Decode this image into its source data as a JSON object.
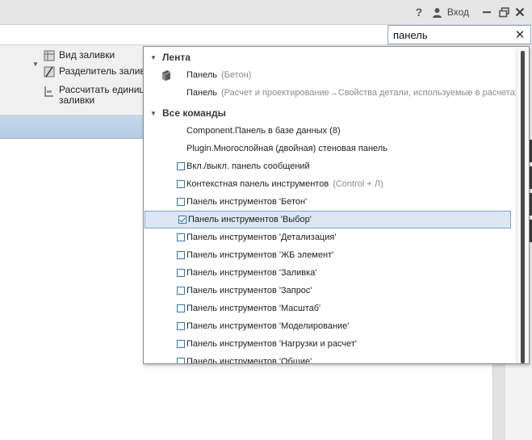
{
  "window": {
    "help_label": "?",
    "login_label": "Вход",
    "icons": {
      "help": "help-icon",
      "user": "user-icon",
      "minimize": "minimize-icon",
      "restore": "restore-icon",
      "close": "close-icon"
    }
  },
  "ribbon": {
    "fill_view_label": "Вид заливки",
    "fill_separator_label": "Разделитель заливк",
    "calc_units_line1": "Рассчитать единиц",
    "calc_units_line2": "заливки"
  },
  "search": {
    "value": "панель",
    "clear_label": "✕"
  },
  "dropdown": {
    "sections": [
      {
        "label": "Лента"
      },
      {
        "label": "Все команды"
      }
    ],
    "ribbon_items": [
      {
        "label": "Панель",
        "hint": "(Бетон)",
        "icon": "panel-icon"
      },
      {
        "label": "Панель",
        "hint": "(Расчет и проектирование→Свойства детали, используемые в расчетах)"
      }
    ],
    "commands": [
      {
        "label": "Component.Панель в базе данных (8)",
        "hint": "",
        "checkbox": false
      },
      {
        "label": "Plugin.Многослойная (двойная) стеновая панель",
        "hint": "",
        "checkbox": false
      },
      {
        "label": "Вкл./выкл. панель сообщений",
        "hint": "",
        "checkbox": true,
        "checked": false
      },
      {
        "label": "Контекстная панель инструментов",
        "hint": "(Control + Л)",
        "checkbox": true,
        "checked": false
      },
      {
        "label": "Панель инструментов 'Бетон'",
        "hint": "",
        "checkbox": true,
        "checked": false
      },
      {
        "label": "Панель инструментов 'Выбор'",
        "hint": "",
        "checkbox": true,
        "checked": true,
        "selected": true
      },
      {
        "label": "Панель инструментов 'Детализация'",
        "hint": "",
        "checkbox": true,
        "checked": false
      },
      {
        "label": "Панель инструментов 'ЖБ элемент'",
        "hint": "",
        "checkbox": true,
        "checked": false
      },
      {
        "label": "Панель инструментов 'Заливка'",
        "hint": "",
        "checkbox": true,
        "checked": false
      },
      {
        "label": "Панель инструментов 'Запрос'",
        "hint": "",
        "checkbox": true,
        "checked": false
      },
      {
        "label": "Панель инструментов 'Масштаб'",
        "hint": "",
        "checkbox": true,
        "checked": false
      },
      {
        "label": "Панель инструментов 'Моделирование'",
        "hint": "",
        "checkbox": true,
        "checked": false
      },
      {
        "label": "Панель инструментов 'Нагрузки и расчет'",
        "hint": "",
        "checkbox": true,
        "checked": false
      },
      {
        "label": "Панель инструментов 'Общие'",
        "hint": "",
        "checkbox": true,
        "checked": false
      }
    ]
  },
  "colors": {
    "accent": "#2a7ab8",
    "selection": "#dce7f3",
    "band": "#b3cbe3"
  }
}
